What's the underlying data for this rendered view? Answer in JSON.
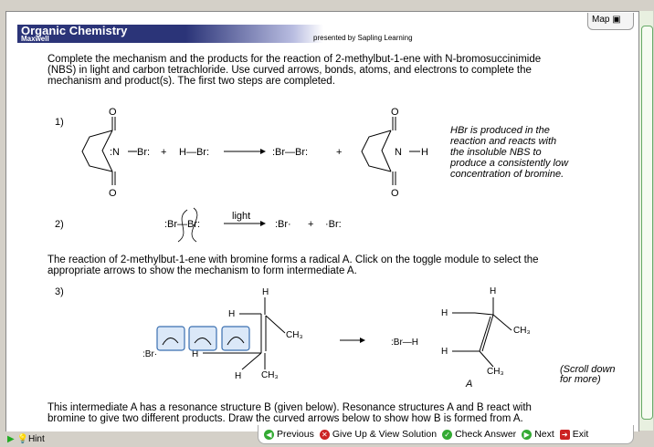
{
  "header": {
    "title": "Organic Chemistry",
    "subtitle": "Maxwell",
    "presented": "presented by Sapling Learning",
    "map": "Map"
  },
  "intro": [
    "Complete the mechanism and the products for the reaction of 2-methylbut-1-ene with N-bromosuccinimide",
    "(NBS) in light and carbon tetrachloride. Use curved arrows, bonds, atoms, and electrons to complete the",
    "mechanism and product(s). The first two steps are completed."
  ],
  "steps": {
    "s1": "1)",
    "s2": "2)",
    "s3": "3)"
  },
  "note": [
    "HBr is produced in the",
    "reaction and reacts with",
    "the insoluble NBS to",
    "produce a consistently low",
    "concentration of bromine."
  ],
  "light": "light",
  "para2": [
    "The reaction of 2-methylbut-1-ene with bromine forms a radical A. Click on the toggle module to select the",
    "appropriate arrows to show the mechanism to form intermediate A."
  ],
  "labels": {
    "A": "A",
    "scroll": [
      "(Scroll down",
      "for more)"
    ]
  },
  "para3": [
    "This intermediate A has a resonance structure B (given below). Resonance structures A and B react with",
    "bromine to give two different products. Draw the curved arrows below to show how B is formed from A."
  ],
  "nav": {
    "previous": "Previous",
    "giveup": "Give Up & View Solution",
    "check": "Check Answer",
    "next": "Next",
    "exit": "Exit",
    "hint": "Hint"
  }
}
